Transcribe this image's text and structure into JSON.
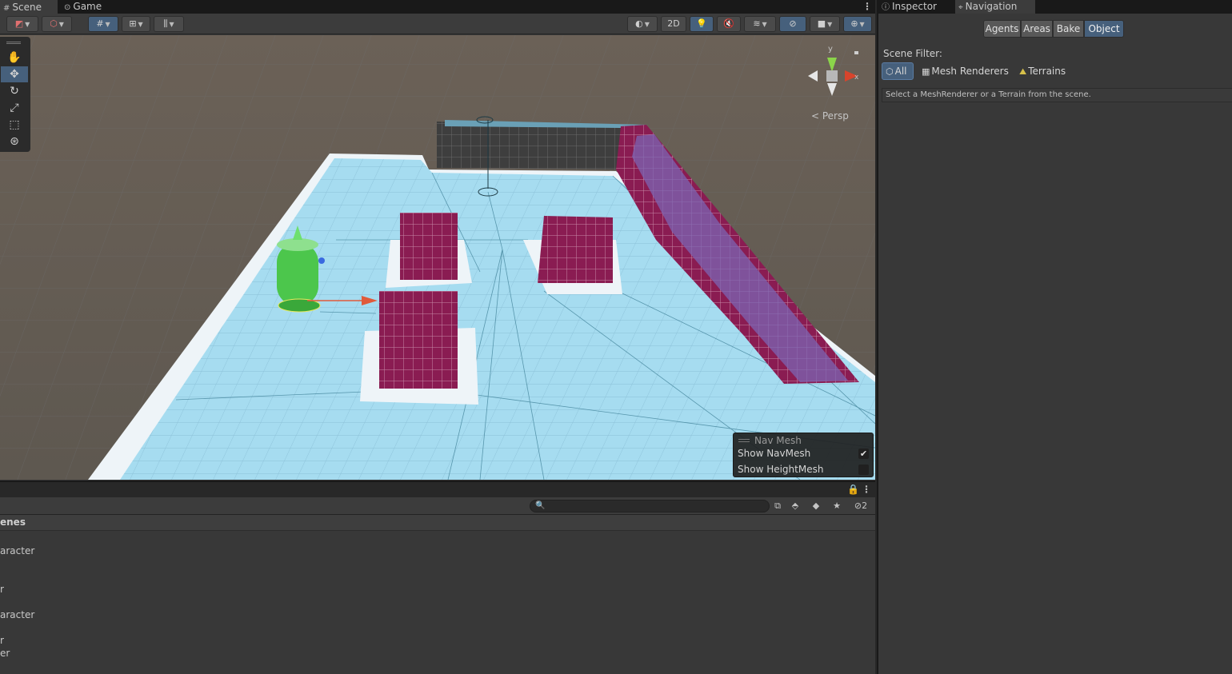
{
  "scene_window": {
    "tabs": [
      {
        "label": "Scene",
        "icon": "scene-hash-icon"
      },
      {
        "label": "Game",
        "icon": "gamepad-icon"
      }
    ],
    "toolbar": {
      "button_2d": "2D"
    },
    "tools": [
      "hand",
      "move",
      "rotate",
      "scale",
      "rect",
      "transform"
    ],
    "selected_tool": "move",
    "persp_label": "< Persp",
    "gizmo_axis_label": "y",
    "navmesh_overlay": {
      "title": "Nav Mesh",
      "show_navmesh_label": "Show NavMesh",
      "show_navmesh": true,
      "show_heightmesh_label": "Show HeightMesh",
      "show_heightmesh": false
    }
  },
  "hierarchy": {
    "search_placeholder": "",
    "hidden_count": "2",
    "scenes_label": "enes",
    "items": [
      "aracter",
      "r",
      "aracter",
      "r",
      "er"
    ]
  },
  "right_panel": {
    "tabs": [
      {
        "label": "Inspector",
        "icon": "info-icon"
      },
      {
        "label": "Navigation",
        "icon": "navigation-icon"
      }
    ],
    "modes": [
      "Agents",
      "Areas",
      "Bake",
      "Object"
    ],
    "active_mode": "Object",
    "scene_filter_label": "Scene Filter:",
    "filters": [
      "All",
      "Mesh Renderers",
      "Terrains"
    ],
    "active_filter": "All",
    "help_text": "Select a MeshRenderer or a Terrain from the scene."
  },
  "colors": {
    "accent_blue": "#46607c",
    "navmesh": "#a6dcf0",
    "obstacle": "#8a1c52",
    "agent": "#4cc64c"
  }
}
